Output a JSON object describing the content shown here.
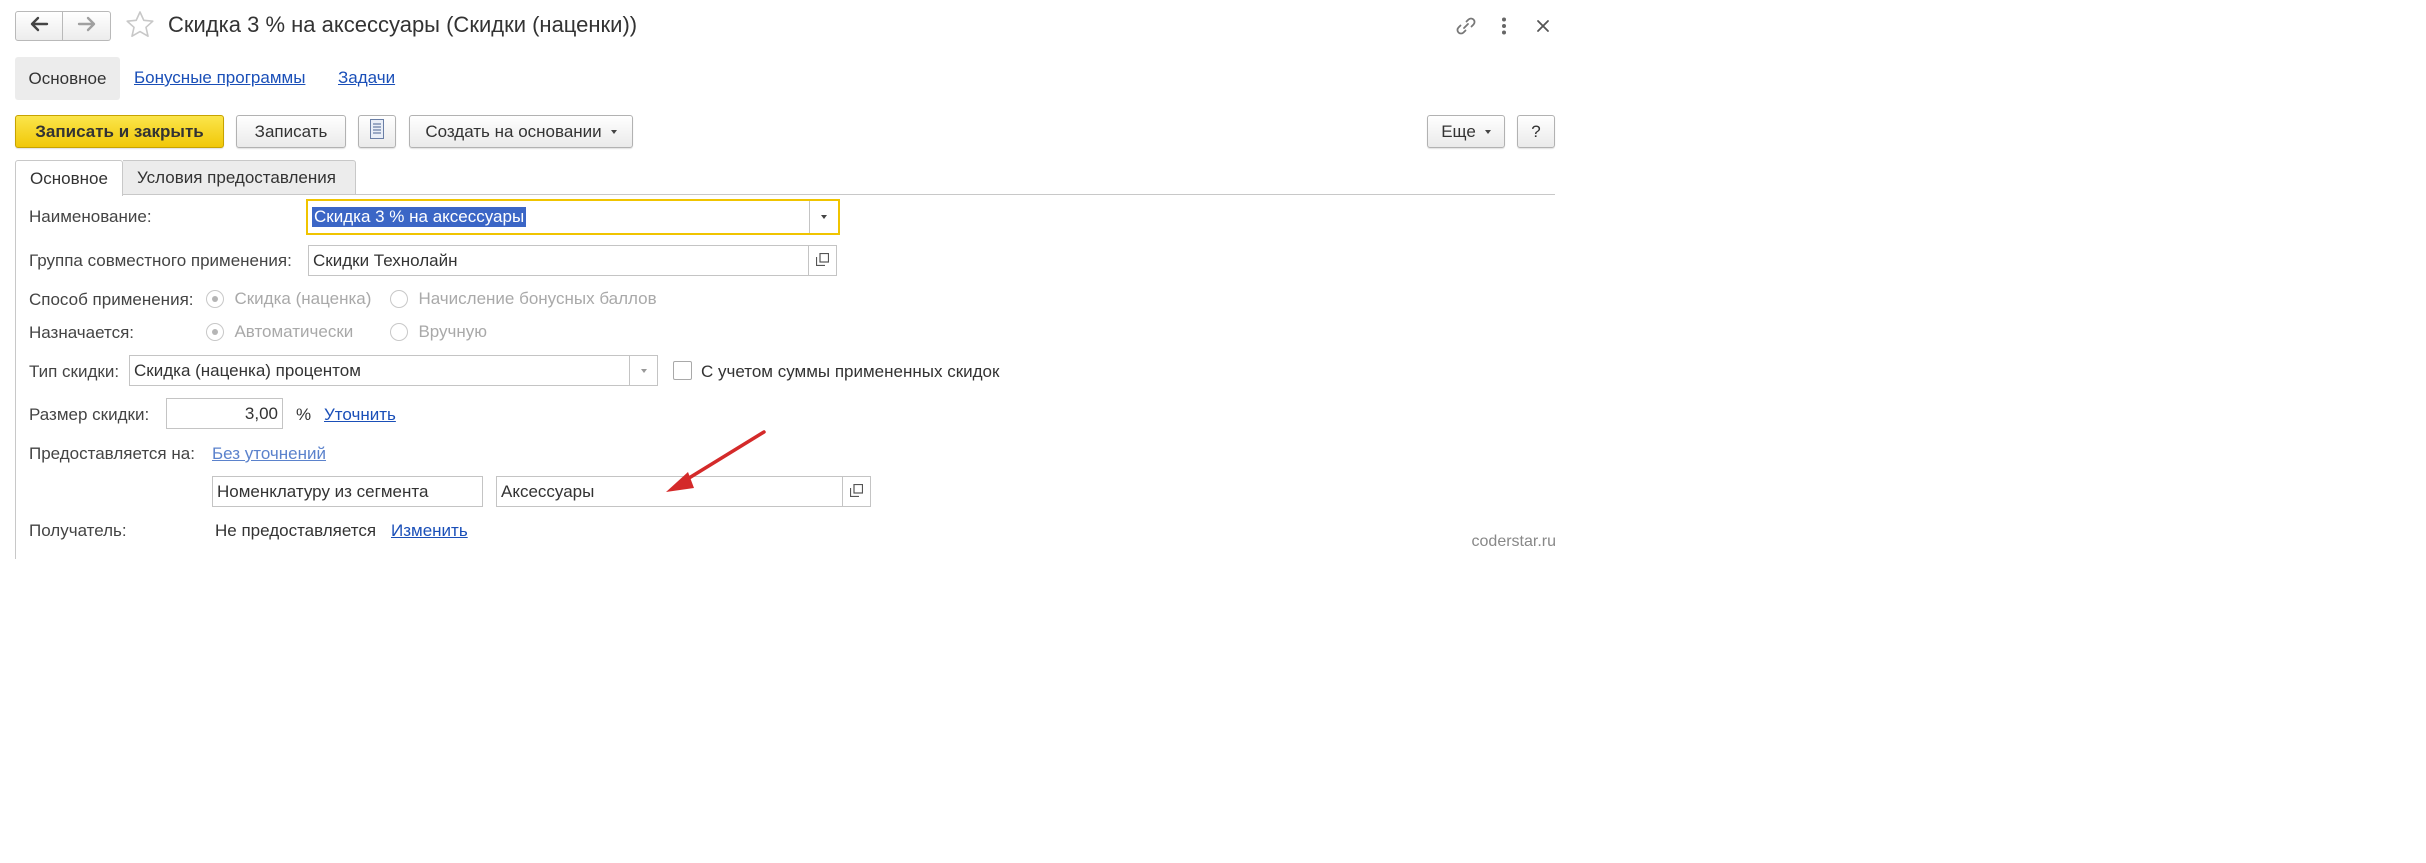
{
  "window": {
    "title": "Скидка 3 % на аксессуары (Скидки (наценки))",
    "icons": [
      "back-arrow-icon",
      "forward-arrow-icon",
      "star-icon",
      "link-icon",
      "more-vertical-icon",
      "close-icon"
    ]
  },
  "section_nav": {
    "items": [
      {
        "label": "Основное",
        "active": true
      },
      {
        "label": "Бонусные программы",
        "active": false
      },
      {
        "label": "Задачи",
        "active": false
      }
    ]
  },
  "toolbar": {
    "save_close_label": "Записать и закрыть",
    "save_label": "Записать",
    "create_based_label": "Создать на основании",
    "more_label": "Еще",
    "help_label": "?"
  },
  "tabs": [
    {
      "label": "Основное",
      "active": true
    },
    {
      "label": "Условия предоставления",
      "active": false
    }
  ],
  "form": {
    "name_label": "Наименование:",
    "name_value": "Скидка 3 % на аксессуары",
    "group_label": "Группа совместного применения:",
    "group_value": "Скидки Технолайн",
    "method_label": "Способ применения:",
    "method_options": [
      {
        "label": "Скидка (наценка)",
        "selected": true
      },
      {
        "label": "Начисление бонусных баллов",
        "selected": false
      }
    ],
    "assigned_label": "Назначается:",
    "assigned_options": [
      {
        "label": "Автоматически",
        "selected": true
      },
      {
        "label": "Вручную",
        "selected": false
      }
    ],
    "discount_type_label": "Тип скидки:",
    "discount_type_value": "Скидка (наценка) процентом",
    "consider_label": "С учетом суммы примененных скидок",
    "consider_checked": false,
    "size_label": "Размер скидки:",
    "size_value": "3,00",
    "size_unit": "%",
    "refine_link": "Уточнить",
    "provided_label": "Предоставляется на:",
    "provided_link": "Без уточнений",
    "segment_value": "Номенклатуру из сегмента",
    "segment_target": "Аксессуары",
    "recipient_label": "Получатель:",
    "recipient_value": "Не предоставляется",
    "recipient_link": "Изменить"
  },
  "watermark": "coderstar.ru",
  "colors": {
    "primary_button": "#f5d20f",
    "link": "#1a4fb8",
    "focus_border": "#f0c400",
    "selection": "#3b66c6",
    "annotation_arrow": "#d42a2a"
  }
}
